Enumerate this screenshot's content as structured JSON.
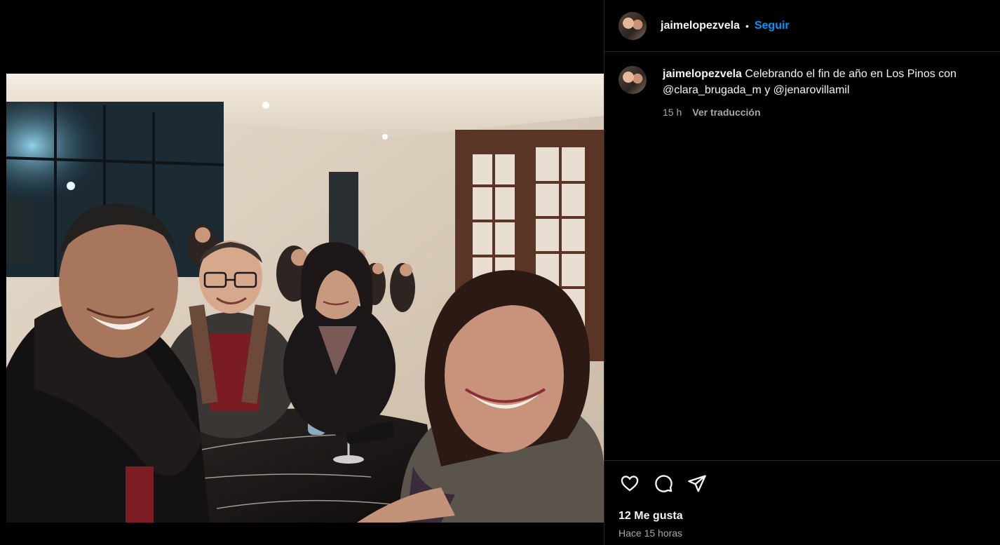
{
  "post": {
    "username": "jaimelopezvela",
    "separator": "•",
    "follow_label": "Seguir",
    "caption": {
      "username": "jaimelopezvela",
      "text": "Celebrando el fin de año en Los Pinos con @clara_brugada_m y @jenarovillamil",
      "age": "15 h",
      "translate_label": "Ver traducción"
    },
    "actions": {
      "like_icon": "heart-icon",
      "comment_icon": "comment-icon",
      "share_icon": "paper-plane-icon"
    },
    "likes_label": "12 Me gusta",
    "timestamp": "Hace 15 horas"
  }
}
